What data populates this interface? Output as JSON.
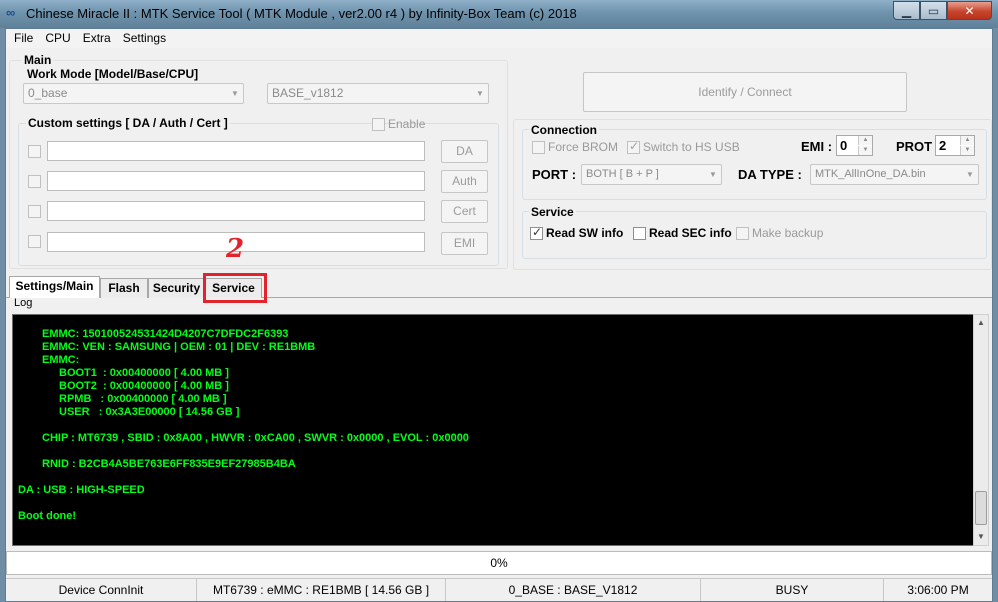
{
  "window": {
    "title": "Chinese Miracle II : MTK Service Tool ( MTK Module , ver2.00 r4  ) by Infinity-Box Team (c) 2018"
  },
  "menu": [
    "File",
    "CPU",
    "Extra",
    "Settings"
  ],
  "main": {
    "group_label": "Main",
    "work_mode": {
      "label": "Work Mode [Model/Base/CPU]",
      "model_value": "0_base",
      "base_value": "BASE_v1812"
    },
    "custom": {
      "label": "Custom settings [ DA / Auth / Cert ]",
      "enable_label": "Enable",
      "rows": [
        {
          "button": "DA"
        },
        {
          "button": "Auth"
        },
        {
          "button": "Cert"
        },
        {
          "button": "EMI"
        }
      ]
    },
    "identify_button": "Identify / Connect"
  },
  "connection": {
    "label": "Connection",
    "force_brom": "Force BROM",
    "switch_hs": "Switch to HS USB",
    "emi_label": "EMI :",
    "emi_value": "0",
    "prot_label": "PROT :",
    "prot_value": "2",
    "port_label": "PORT :",
    "port_value": "BOTH [ B + P ]",
    "da_type_label": "DA TYPE :",
    "da_type_value": "MTK_AllInOne_DA.bin"
  },
  "service": {
    "label": "Service",
    "read_sw": "Read SW info",
    "read_sec": "Read SEC info",
    "make_backup": "Make backup"
  },
  "tabs": [
    "Settings/Main",
    "Flash",
    "Security",
    "Service"
  ],
  "annotation": {
    "step_number": "2"
  },
  "log": {
    "label": "Log",
    "lines": [
      "EMMC: 150100524531424D4207C7DFDC2F6393",
      "EMMC: VEN : SAMSUNG | OEM : 01 | DEV : RE1BMB",
      "EMMC:",
      "BOOT1  : 0x00400000 [ 4.00 MB ]",
      "BOOT2  : 0x00400000 [ 4.00 MB ]",
      "RPMB   : 0x00400000 [ 4.00 MB ]",
      "USER   : 0x3A3E00000 [ 14.56 GB ]",
      "CHIP : MT6739 , SBID : 0x8A00 , HWVR : 0xCA00 , SWVR : 0x0000 , EVOL : 0x0000",
      "RNID : B2CB4A5BE763E6FF835E9EF27985B4BA",
      "DA : USB : HIGH-SPEED",
      "Boot done!"
    ]
  },
  "progress": {
    "value": 0,
    "text": "0%"
  },
  "status": [
    "Device ConnInit",
    "MT6739 : eMMC : RE1BMB  [ 14.56 GB ]",
    "0_BASE : BASE_V1812",
    "BUSY",
    "3:06:00 PM"
  ],
  "colors": {
    "log_text": "#00ff18",
    "log_bg": "#000000",
    "annotation": "#e3232b"
  }
}
